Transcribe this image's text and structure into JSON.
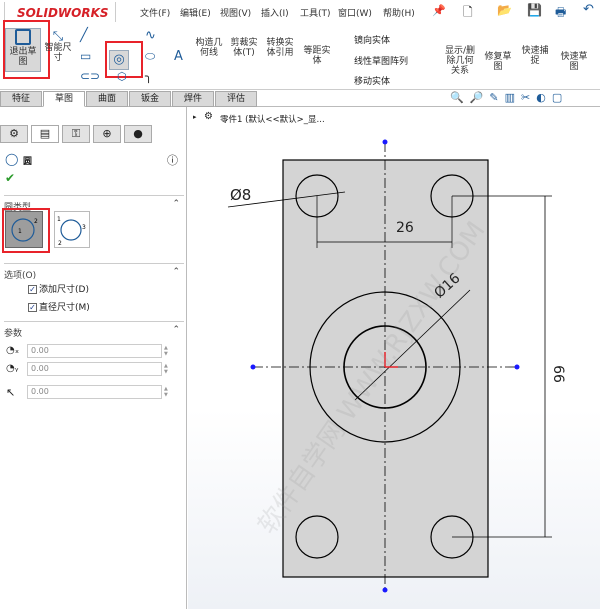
{
  "app": {
    "logo": "SOLIDWORKS"
  },
  "menu": [
    "文件(F)",
    "编辑(E)",
    "视图(V)",
    "插入(I)",
    "工具(T)",
    "窗口(W)",
    "帮助(H)"
  ],
  "ribbon": {
    "exit_sketch": "退出草图",
    "smart_dim": "智能尺寸",
    "construction": "构造几何线",
    "trim": "剪裁实体(T)",
    "convert": "转换实体引用",
    "offset": "等距实体",
    "mirror": "镜向实体",
    "linear_pattern": "线性草图阵列",
    "move": "移动实体",
    "show_delete": "显示/删除几何关系",
    "repair": "修复草图",
    "quick_snap": "快速捕捉",
    "rapid_sketch": "快速草图"
  },
  "tabs": [
    "特征",
    "草图",
    "曲面",
    "钣金",
    "焊件",
    "评估"
  ],
  "active_tab": "草图",
  "tree": {
    "part": "零件1 (默认<<默认>_显..."
  },
  "panel": {
    "title": "圆",
    "circle_type": "圆类型",
    "options": "选项(O)",
    "add_dim": "添加尺寸(D)",
    "diam_dim": "直径尺寸(M)",
    "params": "参数",
    "x": "0.00",
    "y": "0.00",
    "r": "0.00"
  },
  "drawing": {
    "dim_d8": "Ø8",
    "dim_26": "26",
    "dim_d16": "Ø16",
    "dim_66": "66"
  },
  "watermark": "软件自学网 WWW.RJZXW.COM",
  "colors": {
    "accent": "#1f5c99",
    "highlight": "#e8232a",
    "sketch_fill": "#d4d4d4"
  }
}
